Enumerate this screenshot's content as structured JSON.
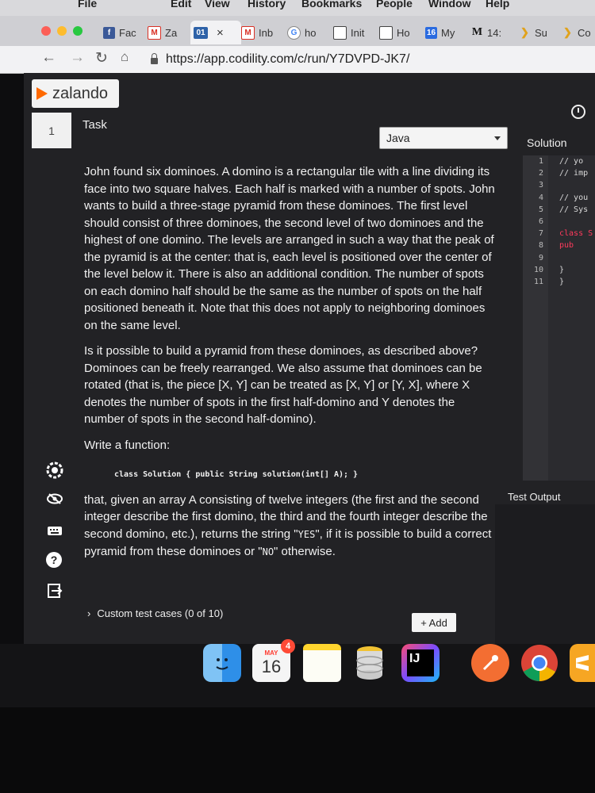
{
  "mac_menu": [
    "File",
    "Edit",
    "View",
    "History",
    "Bookmarks",
    "People",
    "Window",
    "Help"
  ],
  "browser": {
    "tabs": [
      {
        "label": "Fac",
        "icon": "facebook-icon"
      },
      {
        "label": "Za",
        "icon": "gmail-icon"
      },
      {
        "label": "01",
        "icon": "codility-icon"
      },
      {
        "label": "Inb",
        "icon": "gmail-icon"
      },
      {
        "label": "ho",
        "icon": "google-icon"
      },
      {
        "label": "Init",
        "icon": "document-icon"
      },
      {
        "label": "Ho",
        "icon": "document-icon"
      },
      {
        "label": "My",
        "icon": "calendar-icon"
      },
      {
        "label": "14:",
        "icon": "medium-icon"
      },
      {
        "label": "Su",
        "icon": "puzzle-icon"
      },
      {
        "label": "Co",
        "icon": "puzzle-icon"
      }
    ],
    "tab_close": "×",
    "url": "https://app.codility.com/c/run/Y7DVPD-JK7/"
  },
  "app": {
    "logo_text": "zalando",
    "task_number": "1",
    "task_label": "Task",
    "language": "Java",
    "solution_tab": "Solution",
    "test_output_label": "Test Output",
    "custom_tests_label": "Custom test cases (0 of 10)",
    "add_button": "+ Add",
    "description": {
      "p1": "John found six dominoes. A domino is a rectangular tile with a line dividing its face into two square halves. Each half is marked with a number of spots. John wants to build a three-stage pyramid from these dominoes. The first level should consist of three dominoes, the second level of two dominoes and the highest of one domino. The levels are arranged in such a way that the peak of the pyramid is at the center: that is, each level is positioned over the center of the level below it. There is also an additional condition. The number of spots on each domino half should be the same as the number of spots on the half positioned beneath it. Note that this does not apply to neighboring dominoes on the same level.",
      "p2": "Is it possible to build a pyramid from these dominoes, as described above? Dominoes can be freely rearranged. We also assume that dominoes can be rotated (that is, the piece [X, Y] can be treated as [X, Y] or [Y, X], where X denotes the number of spots in the first half-domino and Y denotes the number of spots in the second half-domino).",
      "p3": "Write a function:",
      "signature": "class Solution { public String solution(int[] A); }",
      "p4_before_yes": "that, given an array A consisting of twelve integers (the first and the second integer describe the first domino, the third and the fourth integer describe the second domino, etc.), returns the string \"",
      "yes_value": "YES",
      "p4_between": "\", if it is possible to build a correct pyramid from these dominoes or \"",
      "no_value": "NO",
      "p4_after_no": "\" otherwise."
    },
    "editor_lines": [
      {
        "num": "1",
        "text": "// yo",
        "color": "#d9d9d9"
      },
      {
        "num": "2",
        "text": "// imp",
        "color": "#d9d9d9"
      },
      {
        "num": "3",
        "text": "",
        "color": "#d9d9d9"
      },
      {
        "num": "4",
        "text": "// you",
        "color": "#d9d9d9"
      },
      {
        "num": "5",
        "text": "// Sys",
        "color": "#d9d9d9"
      },
      {
        "num": "6",
        "text": "",
        "color": "#d9d9d9"
      },
      {
        "num": "7",
        "text": "class S",
        "color": "#ff3a5c"
      },
      {
        "num": "8",
        "text": "  pub",
        "color": "#ff3a5c"
      },
      {
        "num": "9",
        "text": "",
        "color": "#d9d9d9"
      },
      {
        "num": "10",
        "text": "  }",
        "color": "#d9d9d9"
      },
      {
        "num": "11",
        "text": "}",
        "color": "#d9d9d9"
      }
    ]
  },
  "dock": {
    "calendar_month": "MAY",
    "calendar_day": "16",
    "calendar_badge": "4",
    "intellij_label": "IJ"
  }
}
